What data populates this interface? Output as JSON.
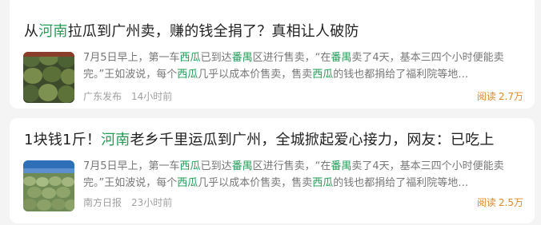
{
  "feed": {
    "items": [
      {
        "title_parts": [
          "从",
          "河南",
          "拉瓜到广州卖，赚的钱全捐了？真相让人破防"
        ],
        "summary_parts": [
          "7月5日早上，第一车",
          "西瓜",
          "已到达",
          "番禺",
          "区进行售卖，“在",
          "番禺",
          "卖了4天，基本三四个小时便能卖完。”王如波说，每个",
          "西瓜",
          "几乎以成本价售卖，售卖",
          "西瓜",
          "的钱也都捐给了福利院等地…"
        ],
        "source": "广东发布",
        "time": "14小时前",
        "reads_label": "阅读",
        "reads_value": "2.7万",
        "thumb_icon": "watermelon-pile-photo"
      },
      {
        "title_parts": [
          "1块钱1斤！",
          "河南",
          "老乡千里运瓜到广州，全城掀起爱心接力，网友：已吃上"
        ],
        "summary_parts": [
          "7月5日早上，第一车",
          "西瓜",
          "已到达",
          "番禺",
          "区进行售卖，“在",
          "番禺",
          "卖了4天，基本三四个小时便能卖完。”王如波说，每个",
          "西瓜",
          "几乎以成本价售卖，售卖",
          "西瓜",
          "的钱也都捐给了福利院等地…"
        ],
        "source": "南方日报",
        "time": "23小时前",
        "reads_label": "阅读",
        "reads_value": "2.5万",
        "thumb_icon": "watermelon-truck-photo"
      }
    ]
  },
  "colors": {
    "highlight": "#1e9e57",
    "reads": "#e0892a",
    "meta": "#a0a0a0",
    "title": "#222222"
  }
}
